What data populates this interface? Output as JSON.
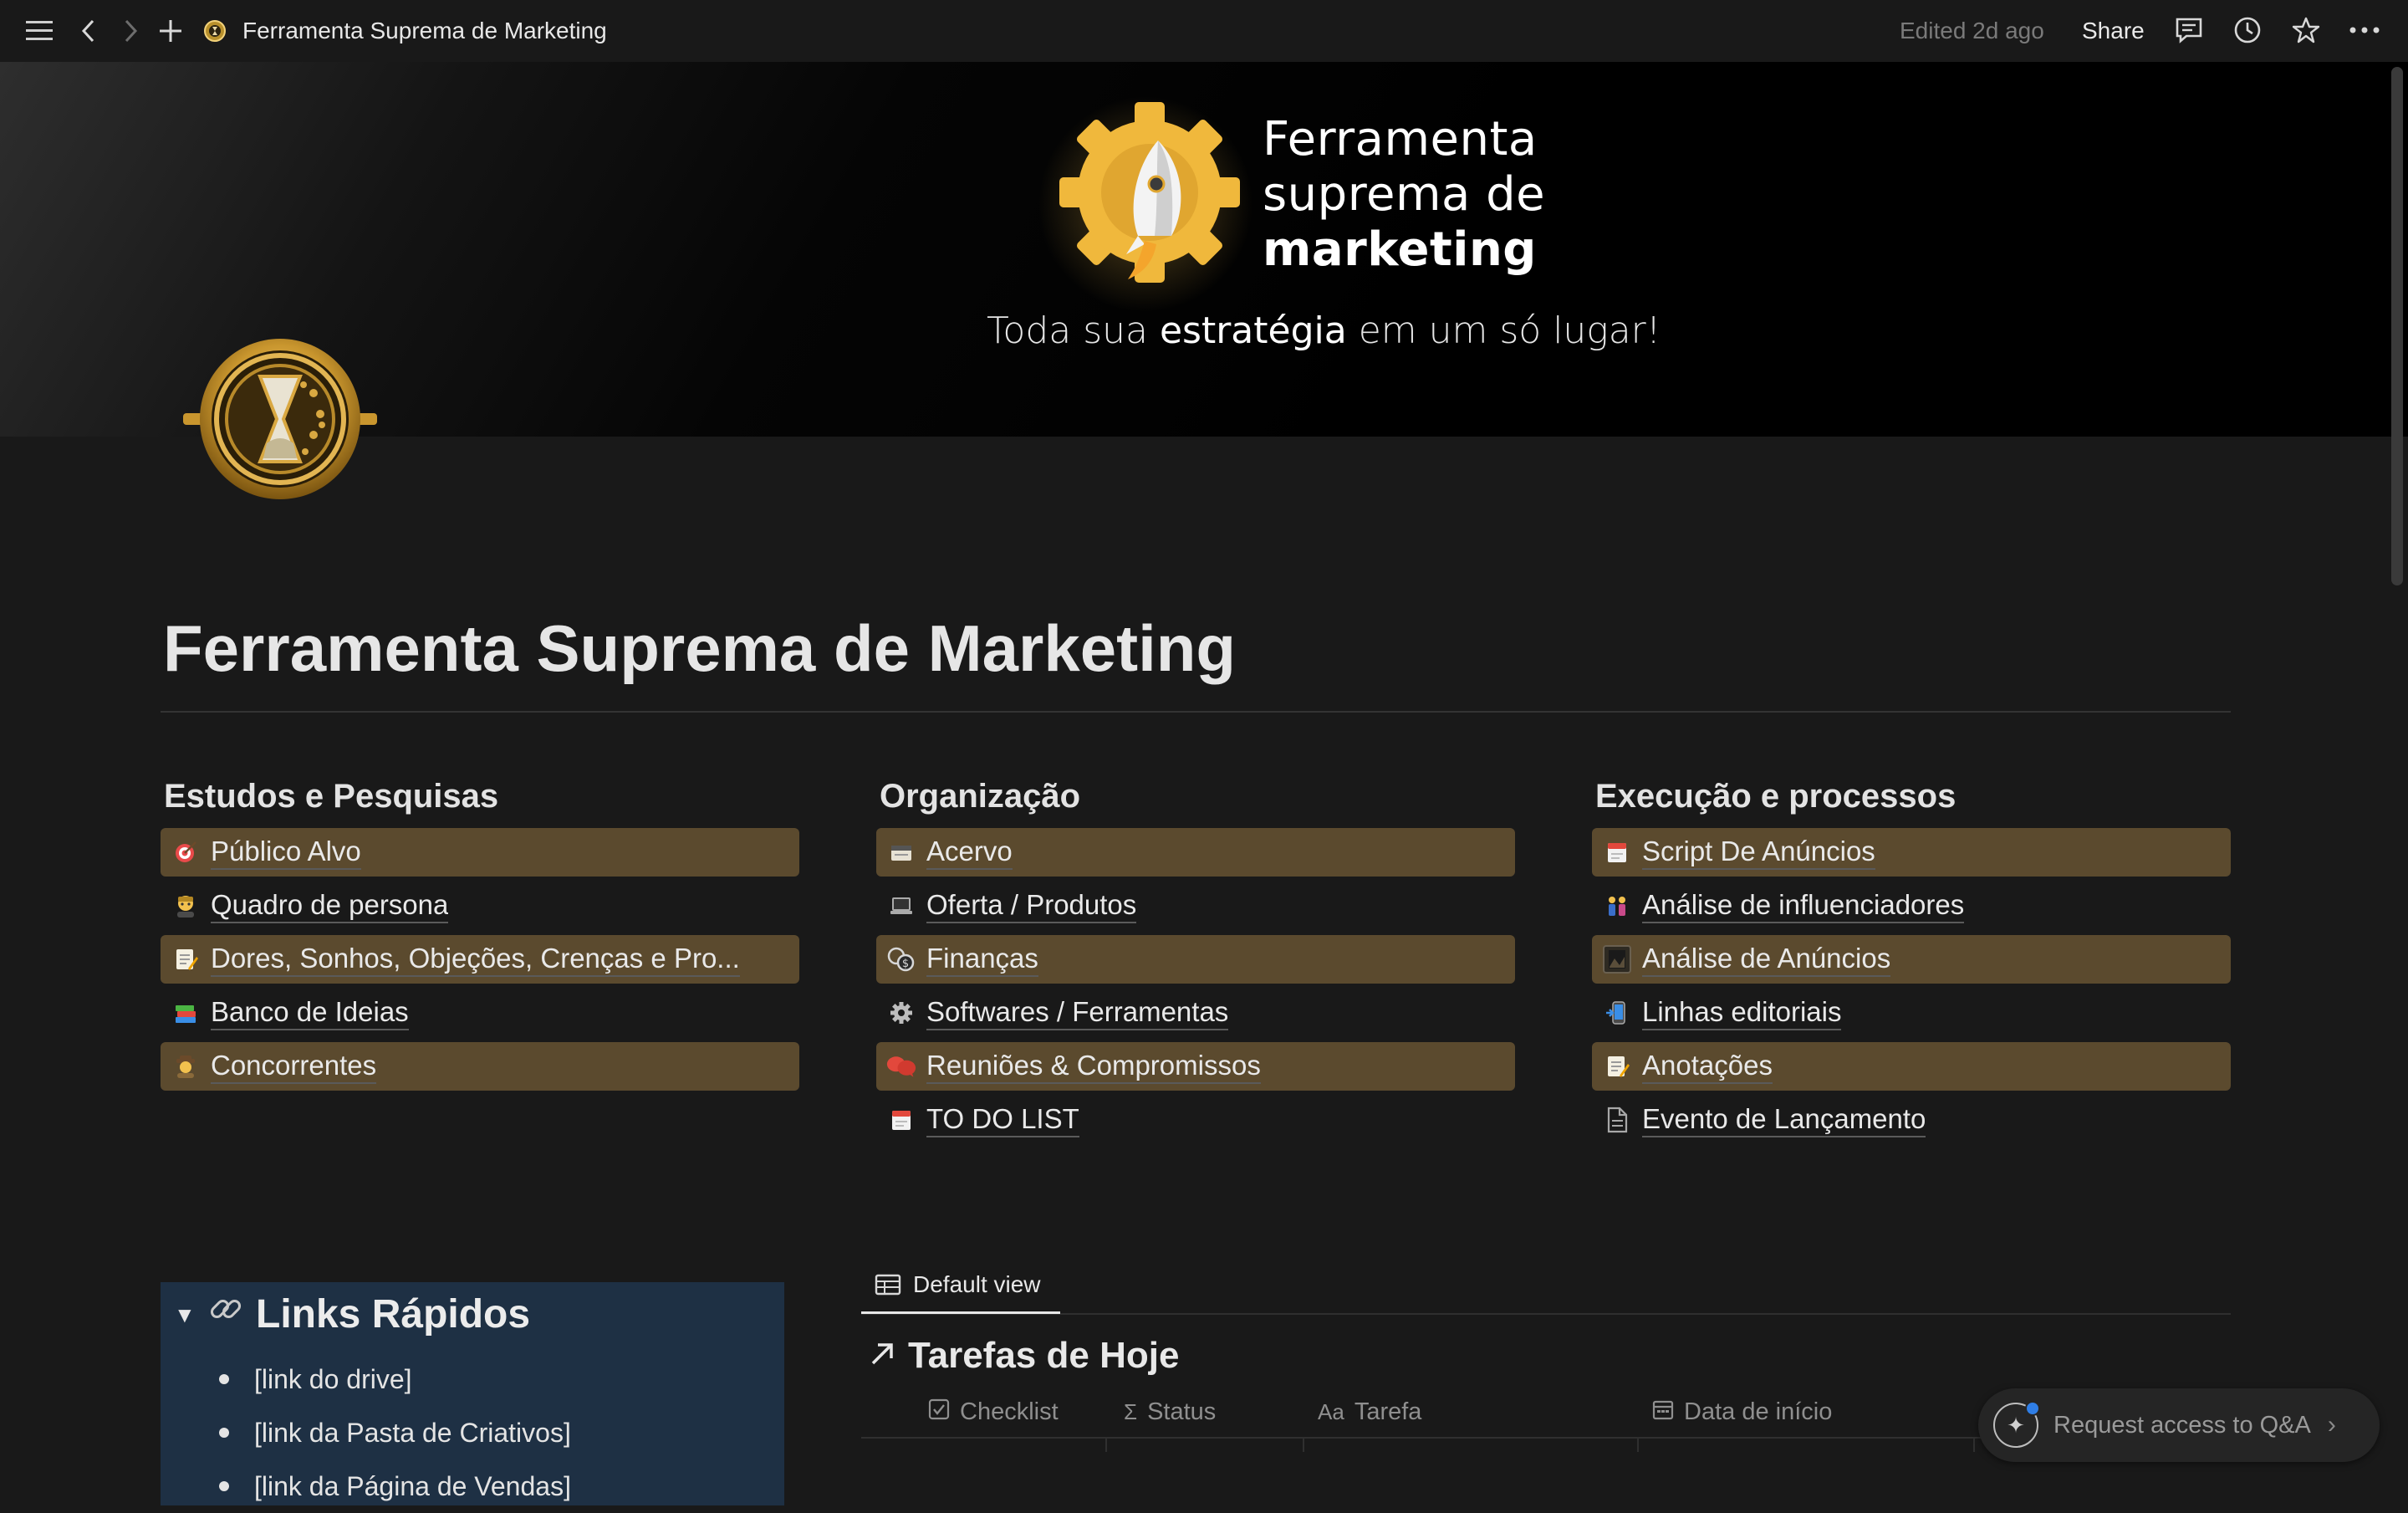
{
  "topbar": {
    "breadcrumb": "Ferramenta Suprema de Marketing",
    "edited": "Edited 2d ago",
    "share": "Share"
  },
  "cover": {
    "brand_line1": "Ferramenta",
    "brand_line2": "suprema de",
    "brand_line3": "marketing",
    "tagline_pre": "Toda sua ",
    "tagline_bold": "estratégia",
    "tagline_post": " em um só lugar!"
  },
  "page": {
    "title": "Ferramenta Suprema de Marketing"
  },
  "columns": [
    {
      "heading": "Estudos e Pesquisas",
      "items": [
        {
          "label": "Público Alvo",
          "icon": "dart-target-icon",
          "highlighted": true
        },
        {
          "label": "Quadro de persona",
          "icon": "person-icon",
          "highlighted": false
        },
        {
          "label": "Dores, Sonhos, Objeções, Crenças e Pro...",
          "icon": "memo-icon",
          "highlighted": true
        },
        {
          "label": "Banco de Ideias",
          "icon": "books-icon",
          "highlighted": false
        },
        {
          "label": "Concorrentes",
          "icon": "detective-icon",
          "highlighted": true
        }
      ]
    },
    {
      "heading": "Organização",
      "items": [
        {
          "label": "Acervo",
          "icon": "card-index-icon",
          "highlighted": true
        },
        {
          "label": "Oferta / Produtos",
          "icon": "laptop-icon",
          "highlighted": false
        },
        {
          "label": "Finanças",
          "icon": "coins-icon",
          "highlighted": true
        },
        {
          "label": "Softwares / Ferramentas",
          "icon": "gear-icon",
          "highlighted": false
        },
        {
          "label": "Reuniões & Compromissos",
          "icon": "speech-bubbles-icon",
          "highlighted": true
        },
        {
          "label": "TO DO LIST",
          "icon": "calendar-icon",
          "highlighted": false
        }
      ]
    },
    {
      "heading": "Execução e processos",
      "items": [
        {
          "label": "Script De Anúncios",
          "icon": "calendar-icon",
          "highlighted": true
        },
        {
          "label": "Análise de influenciadores",
          "icon": "people-icon",
          "highlighted": false
        },
        {
          "label": "Análise de Anúncios",
          "icon": "image-icon",
          "highlighted": true
        },
        {
          "label": "Linhas editoriais",
          "icon": "phone-icon",
          "highlighted": false
        },
        {
          "label": "Anotações",
          "icon": "memo-icon",
          "highlighted": true
        },
        {
          "label": "Evento de Lançamento",
          "icon": "page-icon",
          "highlighted": false
        }
      ]
    }
  ],
  "links": {
    "title": "Links Rápidos",
    "items": [
      "[link do drive]",
      "[link da Pasta de Criativos]",
      "[link da Página de Vendas]"
    ]
  },
  "database": {
    "view_label": "Default view",
    "title": "Tarefas de Hoje",
    "columns": [
      {
        "label": "Checklist",
        "icon": "checkbox-icon"
      },
      {
        "label": "Status",
        "icon": "sigma-icon"
      },
      {
        "label": "Tarefa",
        "icon_text": "Aa"
      },
      {
        "label": "Data de início",
        "icon": "calendar-icon"
      }
    ]
  },
  "qa": {
    "label": "Request access to Q&A"
  },
  "colors": {
    "background": "#191919",
    "highlight": "#5b4a2e",
    "toggle_bg": "#1e3044",
    "accent_gold": "#e8b73a"
  }
}
